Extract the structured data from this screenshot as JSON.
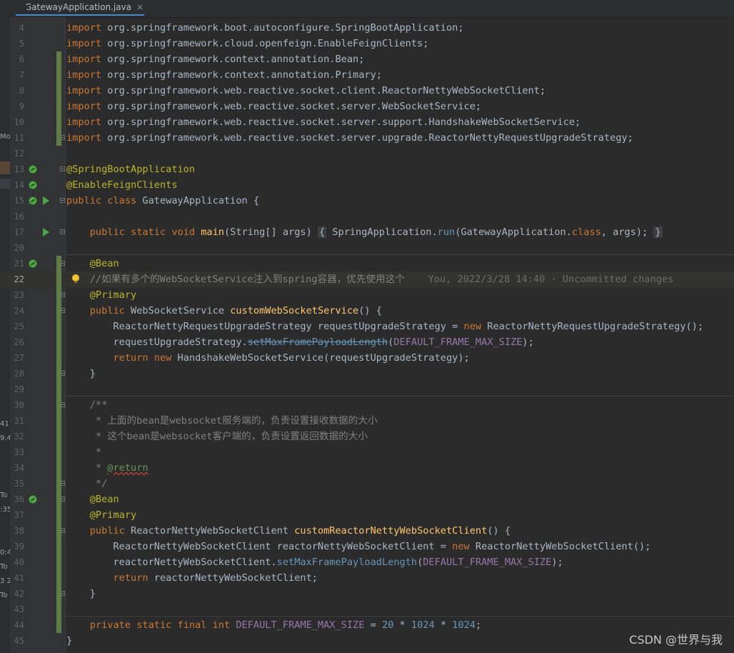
{
  "tab": {
    "title": "GatewayApplication.java",
    "close": "×"
  },
  "left_strip": {
    "fragments": [
      "Mo",
      "41",
      "9.4",
      "To",
      ":35",
      "0:4",
      "To",
      "3 2",
      "To"
    ]
  },
  "lines": [
    {
      "n": "4",
      "tokens": [
        [
          "kw",
          "import "
        ],
        [
          "cls",
          "org.springframework.boot.autoconfigure.SpringBootApplication;"
        ]
      ]
    },
    {
      "n": "5",
      "tokens": [
        [
          "kw",
          "import "
        ],
        [
          "cls",
          "org.springframework.cloud.openfeign.EnableFeignClients;"
        ]
      ]
    },
    {
      "n": "6",
      "tokens": [
        [
          "kw",
          "import "
        ],
        [
          "cls",
          "org.springframework.context.annotation.Bean;"
        ]
      ]
    },
    {
      "n": "7",
      "tokens": [
        [
          "kw",
          "import "
        ],
        [
          "cls",
          "org.springframework.context.annotation.Primary;"
        ]
      ]
    },
    {
      "n": "8",
      "tokens": [
        [
          "kw",
          "import "
        ],
        [
          "cls",
          "org.springframework.web.reactive.socket.client.ReactorNettyWebSocketClient;"
        ]
      ]
    },
    {
      "n": "9",
      "tokens": [
        [
          "kw",
          "import "
        ],
        [
          "cls",
          "org.springframework.web.reactive.socket.server.WebSocketService;"
        ]
      ]
    },
    {
      "n": "10",
      "tokens": [
        [
          "kw",
          "import "
        ],
        [
          "cls",
          "org.springframework.web.reactive.socket.server.support.HandshakeWebSocketService;"
        ]
      ]
    },
    {
      "n": "11",
      "tokens": [
        [
          "kw",
          "import "
        ],
        [
          "cls",
          "org.springframework.web.reactive.socket.server.upgrade.ReactorNettyRequestUpgradeStrategy;"
        ]
      ]
    },
    {
      "n": "12",
      "tokens": []
    },
    {
      "n": "13",
      "tokens": [
        [
          "ann",
          "@SpringBootApplication"
        ]
      ]
    },
    {
      "n": "14",
      "tokens": [
        [
          "ann",
          "@EnableFeignClients"
        ]
      ]
    },
    {
      "n": "15",
      "tokens": [
        [
          "kw",
          "public class "
        ],
        [
          "cls",
          "GatewayApplication {"
        ]
      ]
    },
    {
      "n": "16",
      "tokens": []
    },
    {
      "n": "17",
      "tokens": [
        [
          "cls",
          "    "
        ],
        [
          "kw",
          "public static void "
        ],
        [
          "fn",
          "main"
        ],
        [
          "cls",
          "(String[] args) "
        ],
        [
          "fold-box",
          "{"
        ],
        [
          "cls",
          " SpringApplication."
        ],
        [
          "fncall",
          "run"
        ],
        [
          "cls",
          "(GatewayApplication."
        ],
        [
          "kw",
          "class"
        ],
        [
          "cls",
          ", args); "
        ],
        [
          "fold-box",
          "}"
        ]
      ]
    },
    {
      "n": "20",
      "tokens": []
    },
    {
      "n": "21",
      "tokens": [
        [
          "cls",
          "    "
        ],
        [
          "ann",
          "@Bean"
        ]
      ]
    },
    {
      "n": "22",
      "tokens": [
        [
          "cls",
          "    "
        ],
        [
          "comment",
          "//如果有多个的WebSocketService注入到spring容器，优先使用这个"
        ],
        [
          "hint",
          "    You, 2022/3/28 14:40 · Uncommitted changes"
        ]
      ]
    },
    {
      "n": "23",
      "tokens": [
        [
          "cls",
          "    "
        ],
        [
          "ann",
          "@Primary"
        ]
      ]
    },
    {
      "n": "24",
      "tokens": [
        [
          "cls",
          "    "
        ],
        [
          "kw",
          "public "
        ],
        [
          "cls",
          "WebSocketService "
        ],
        [
          "fn",
          "customWebSocketService"
        ],
        [
          "cls",
          "() {"
        ]
      ]
    },
    {
      "n": "25",
      "tokens": [
        [
          "cls",
          "        ReactorNettyRequestUpgradeStrategy requestUpgradeStrategy = "
        ],
        [
          "kw",
          "new "
        ],
        [
          "cls",
          "ReactorNettyRequestUpgradeStrategy();"
        ]
      ]
    },
    {
      "n": "26",
      "tokens": [
        [
          "cls",
          "        requestUpgradeStrategy."
        ],
        [
          "strike",
          "setMaxFramePayloadLength"
        ],
        [
          "cls",
          "("
        ],
        [
          "const",
          "DEFAULT_FRAME_MAX_SIZE"
        ],
        [
          "cls",
          ");"
        ]
      ]
    },
    {
      "n": "27",
      "tokens": [
        [
          "cls",
          "        "
        ],
        [
          "kw",
          "return new "
        ],
        [
          "cls",
          "HandshakeWebSocketService(requestUpgradeStrategy);"
        ]
      ]
    },
    {
      "n": "28",
      "tokens": [
        [
          "cls",
          "    }"
        ]
      ]
    },
    {
      "n": "29",
      "tokens": []
    },
    {
      "n": "30",
      "tokens": [
        [
          "cls",
          "    "
        ],
        [
          "comment",
          "/**"
        ]
      ]
    },
    {
      "n": "31",
      "tokens": [
        [
          "cls",
          "     "
        ],
        [
          "comment",
          "* 上面的bean是websocket服务端的，负责设置接收数据的大小"
        ]
      ]
    },
    {
      "n": "32",
      "tokens": [
        [
          "cls",
          "     "
        ],
        [
          "comment",
          "* 这个bean是websocket客户端的，负责设置返回数据的大小"
        ]
      ]
    },
    {
      "n": "33",
      "tokens": [
        [
          "cls",
          "     "
        ],
        [
          "comment",
          "*"
        ]
      ]
    },
    {
      "n": "34",
      "tokens": [
        [
          "cls",
          "     "
        ],
        [
          "comment",
          "* "
        ],
        [
          "doctag",
          "@return"
        ]
      ]
    },
    {
      "n": "35",
      "tokens": [
        [
          "cls",
          "     "
        ],
        [
          "comment",
          "*/"
        ]
      ]
    },
    {
      "n": "36",
      "tokens": [
        [
          "cls",
          "    "
        ],
        [
          "ann",
          "@Bean"
        ]
      ]
    },
    {
      "n": "37",
      "tokens": [
        [
          "cls",
          "    "
        ],
        [
          "ann",
          "@Primary"
        ]
      ]
    },
    {
      "n": "38",
      "tokens": [
        [
          "cls",
          "    "
        ],
        [
          "kw",
          "public "
        ],
        [
          "cls",
          "ReactorNettyWebSocketClient "
        ],
        [
          "fn",
          "customReactorNettyWebSocketClient"
        ],
        [
          "cls",
          "() {"
        ]
      ]
    },
    {
      "n": "39",
      "tokens": [
        [
          "cls",
          "        ReactorNettyWebSocketClient reactorNettyWebSocketClient = "
        ],
        [
          "kw",
          "new "
        ],
        [
          "cls",
          "ReactorNettyWebSocketClient();"
        ]
      ]
    },
    {
      "n": "40",
      "tokens": [
        [
          "cls",
          "        reactorNettyWebSocketClient."
        ],
        [
          "fncall",
          "setMaxFramePayloadLength"
        ],
        [
          "cls",
          "("
        ],
        [
          "const",
          "DEFAULT_FRAME_MAX_SIZE"
        ],
        [
          "cls",
          ");"
        ]
      ]
    },
    {
      "n": "41",
      "tokens": [
        [
          "cls",
          "        "
        ],
        [
          "kw",
          "return "
        ],
        [
          "cls",
          "reactorNettyWebSocketClient;"
        ]
      ]
    },
    {
      "n": "42",
      "tokens": [
        [
          "cls",
          "    }"
        ]
      ]
    },
    {
      "n": "43",
      "tokens": []
    },
    {
      "n": "44",
      "tokens": [
        [
          "cls",
          "    "
        ],
        [
          "kw",
          "private static final int "
        ],
        [
          "const",
          "DEFAULT_FRAME_MAX_SIZE"
        ],
        [
          "cls",
          " = "
        ],
        [
          "num",
          "20"
        ],
        [
          "cls",
          " * "
        ],
        [
          "num",
          "1024"
        ],
        [
          "cls",
          " * "
        ],
        [
          "num",
          "1024"
        ],
        [
          "cls",
          ";"
        ]
      ]
    },
    {
      "n": "45",
      "tokens": [
        [
          "cls",
          "}"
        ]
      ]
    }
  ],
  "watermark": "CSDN @世界与我",
  "colors": {
    "background": "#2b2b2b",
    "keyword": "#cc7832",
    "annotation": "#bbb529",
    "method": "#ffc66d",
    "constant": "#9876aa",
    "number": "#6897bb",
    "comment": "#808080",
    "vcs_changed": "#5f7d45"
  }
}
